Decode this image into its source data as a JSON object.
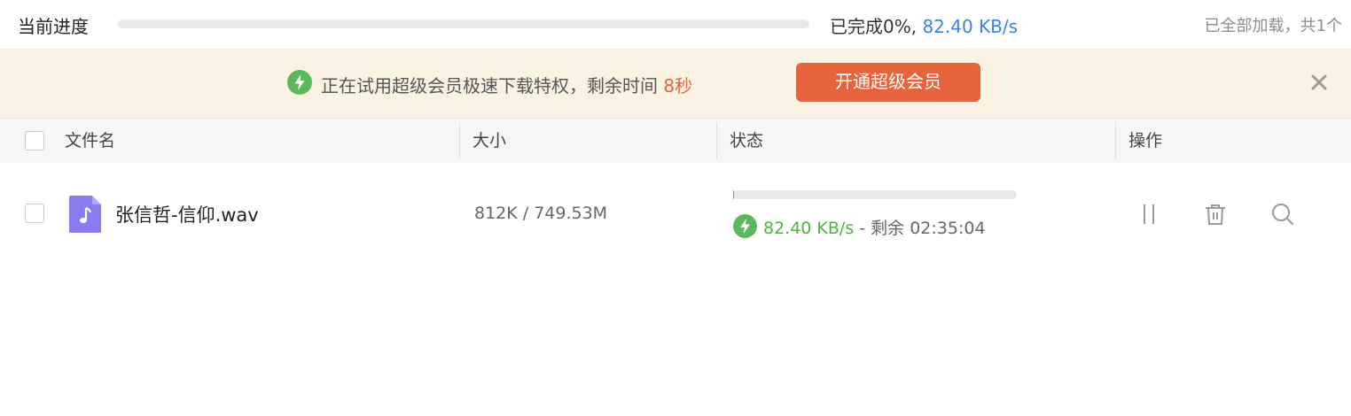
{
  "overall": {
    "title": "当前进度",
    "progress_fraction": 0.0,
    "done_label": "已完成0%,",
    "speed": "82.40 KB/s",
    "load_status": "已全部加载，共1个"
  },
  "promo": {
    "message": "正在试用超级会员极速下载特权，剩余时间",
    "seconds_left": "8秒",
    "button_label": "开通超级会员",
    "close_icon": "close-icon"
  },
  "table": {
    "columns": [
      "文件名",
      "大小",
      "状态",
      "操作"
    ],
    "rows": [
      {
        "file_name": "张信哲-信仰.wav",
        "file_icon": "music-file-icon",
        "size": "812K / 749.53M",
        "progress_fraction": 0.001,
        "speed": "82.40 KB/s",
        "remaining": "- 剩余 02:35:04",
        "actions": [
          "pause-icon",
          "trash-icon",
          "search-icon"
        ]
      }
    ]
  },
  "colors": {
    "accent_blue": "#3b82e6",
    "vip_orange": "#e5643e",
    "speed_green": "#52b043",
    "file_icon_purple": "#8a7cf0"
  }
}
